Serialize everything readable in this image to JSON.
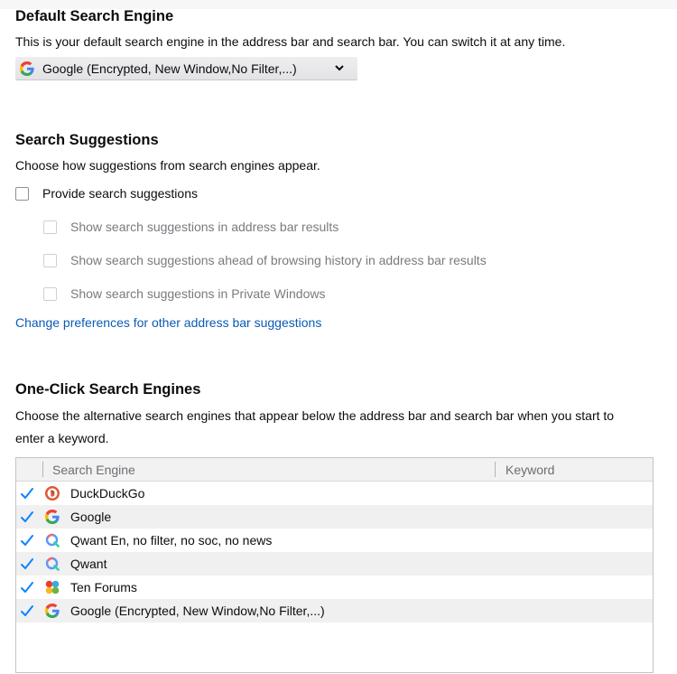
{
  "default_engine": {
    "heading": "Default Search Engine",
    "description": "This is your default search engine in the address bar and search bar. You can switch it at any time.",
    "selected": "Google (Encrypted, New Window,No Filter,...)"
  },
  "suggestions": {
    "heading": "Search Suggestions",
    "description": "Choose how suggestions from search engines appear.",
    "provide_label": "Provide search suggestions",
    "sub_options": [
      "Show search suggestions in address bar results",
      "Show search suggestions ahead of browsing history in address bar results",
      "Show search suggestions in Private Windows"
    ],
    "link": "Change preferences for other address bar suggestions"
  },
  "one_click": {
    "heading": "One-Click Search Engines",
    "description_line1": "Choose the alternative search engines that appear below the address bar and search bar when you start to",
    "description_line2": "enter a keyword.",
    "columns": [
      "Search Engine",
      "Keyword"
    ],
    "engines": [
      {
        "name": "DuckDuckGo",
        "icon": "duckduckgo-icon",
        "checked": true
      },
      {
        "name": "Google",
        "icon": "google-icon",
        "checked": true
      },
      {
        "name": "Qwant En, no filter, no soc, no news",
        "icon": "qwant-icon",
        "checked": true
      },
      {
        "name": "Qwant",
        "icon": "qwant-icon",
        "checked": true
      },
      {
        "name": "Ten Forums",
        "icon": "tenforums-icon",
        "checked": true
      },
      {
        "name": "Google (Encrypted, New Window,No Filter,...)",
        "icon": "google-icon",
        "checked": true
      }
    ]
  },
  "colors": {
    "link": "#0a5bb5",
    "check": "#0a84ff",
    "duckduckgo": "#de5833",
    "qwant": "#5c97ff"
  }
}
